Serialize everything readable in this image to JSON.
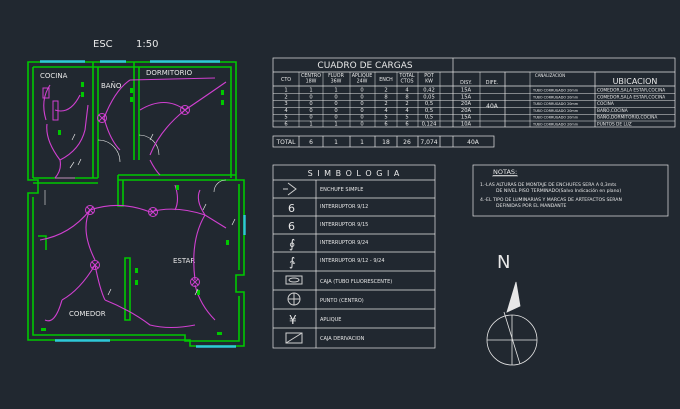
{
  "plan": {
    "scale_label": "ESC",
    "scale_value": "1:50",
    "rooms": [
      "COCINA",
      "BAÑO",
      "DORMITORIO",
      "ESTAR",
      "COMEDOR"
    ]
  },
  "load_table": {
    "title": "CUADRO  DE  CARGAS",
    "headers": [
      "CTO",
      "CENTRO\n18W",
      "FLUOR\n36W",
      "APLIQUE\n24W",
      "ENCH",
      "TOTAL\nCTOS",
      "POT\nKW",
      "DISY.",
      "DIFE.",
      "CANALIZACION",
      "UBICACION"
    ],
    "rows": [
      {
        "cto": "1",
        "centro": "1",
        "fluor": "1",
        "aplique": "0",
        "ench": "2",
        "total": "4",
        "pot": "0,42",
        "disy": "15A",
        "canal": "TUBO CORRUGADO 20mm",
        "ubic": "COMEDOR,SALA ESTAR,COCINA"
      },
      {
        "cto": "2",
        "centro": "0",
        "fluor": "0",
        "aplique": "0",
        "ench": "8",
        "total": "8",
        "pot": "0,05",
        "disy": "15A",
        "canal": "TUBO CORRUGADO 20mm",
        "ubic": "COMEDOR,SALA ESTAR,COCINA"
      },
      {
        "cto": "3",
        "centro": "0",
        "fluor": "0",
        "aplique": "0",
        "ench": "2",
        "total": "2",
        "pot": "0,5",
        "disy": "20A",
        "canal": "TUBO CORRUGADO 20mm",
        "ubic": "COCINA"
      },
      {
        "cto": "4",
        "centro": "0",
        "fluor": "0",
        "aplique": "0",
        "ench": "4",
        "total": "4",
        "pot": "0,5",
        "disy": "20A",
        "canal": "TUBO CORRUGADO 20mm",
        "ubic": "BAÑO,COCINA"
      },
      {
        "cto": "5",
        "centro": "0",
        "fluor": "0",
        "aplique": "0",
        "ench": "5",
        "total": "5",
        "pot": "0,5",
        "disy": "15A",
        "canal": "TUBO CORRUGADO 20mm",
        "ubic": "BAÑO,DORMITORIO,COCINA"
      },
      {
        "cto": "6",
        "centro": "1",
        "fluor": "1",
        "aplique": "0",
        "ench": "6",
        "total": "6",
        "pot": "0,124",
        "disy": "10A",
        "canal": "TUBO CORRUGADO 20mm",
        "ubic": "PUNTOS DE LUZ"
      }
    ],
    "diferencial": "40A",
    "total": {
      "label": "TOTAL",
      "centro": "6",
      "fluor": "1",
      "aplique": "1",
      "ench": "18",
      "total": "26",
      "pot": "7,074",
      "dife": "40A"
    }
  },
  "symbology": {
    "title": "S I M B O L O G I A",
    "items": [
      {
        "icon": "outlet-icon",
        "label": "ENCHUFE SIMPLE"
      },
      {
        "icon": "switch-9-12-icon",
        "label": "INTERRUPTOR 9/12"
      },
      {
        "icon": "switch-9-15-icon",
        "label": "INTERRUPTOR 9/15"
      },
      {
        "icon": "switch-9-24-icon",
        "label": "INTERRUPTOR 9/24"
      },
      {
        "icon": "switch-9-12-9-24-icon",
        "label": "INTERRUPTOR 9/12 - 9/24"
      },
      {
        "icon": "fluorescent-tube-icon",
        "label": "CAJA (TUBO FLUORESCENTE)"
      },
      {
        "icon": "ceiling-light-icon",
        "label": "PUNTO (CENTRO)"
      },
      {
        "icon": "wall-light-icon",
        "label": "APLIQUE"
      },
      {
        "icon": "junction-box-icon",
        "label": "CAJA DERIVACION"
      }
    ]
  },
  "notes": {
    "title": "NOTAS:",
    "items": [
      "1.-LAS ALTURAS DE MONTAJE DE ENCHUFES SERA A 0,3mts DE NIVEL PISO TERMINADO(Salvo Indicación en plano)",
      "4.-EL TIPO DE LUMINARIAS Y MARCAS DE ARTEFACTOS SERAN DEFINIDAS POR EL MANDANTE"
    ]
  },
  "north": {
    "label": "N"
  },
  "colors": {
    "background": "#212830",
    "walls": "#00c800",
    "wiring": "#d040d0",
    "linework": "#e6e6e6",
    "windows": "#2ec8d8",
    "symbols": "#d0d0d0"
  }
}
